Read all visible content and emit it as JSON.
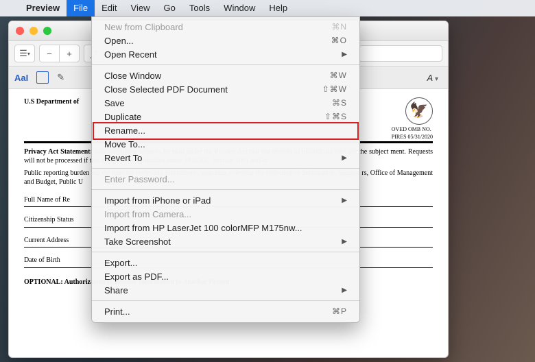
{
  "menubar": {
    "app": "Preview",
    "items": [
      "File",
      "Edit",
      "View",
      "Go",
      "Tools",
      "Window",
      "Help"
    ],
    "active": "File"
  },
  "file_menu": [
    {
      "label": "New from Clipboard",
      "shortcut": "⌘N",
      "disabled": true
    },
    {
      "label": "Open...",
      "shortcut": "⌘O"
    },
    {
      "label": "Open Recent",
      "submenu": true
    },
    {
      "sep": true
    },
    {
      "label": "Close Window",
      "shortcut": "⌘W"
    },
    {
      "label": "Close Selected PDF Document",
      "shortcut": "⇧⌘W"
    },
    {
      "label": "Save",
      "shortcut": "⌘S"
    },
    {
      "label": "Duplicate",
      "shortcut": "⇧⌘S"
    },
    {
      "label": "Rename..."
    },
    {
      "label": "Move To..."
    },
    {
      "label": "Revert To",
      "submenu": true
    },
    {
      "sep": true
    },
    {
      "label": "Enter Password...",
      "disabled": true
    },
    {
      "sep": true
    },
    {
      "label": "Import from iPhone or iPad",
      "submenu": true
    },
    {
      "label": "Import from Camera...",
      "disabled": true
    },
    {
      "label": "Import from HP LaserJet 100 colorMFP M175nw..."
    },
    {
      "label": "Take Screenshot",
      "submenu": true
    },
    {
      "sep": true
    },
    {
      "label": "Export..."
    },
    {
      "label": "Export as PDF..."
    },
    {
      "label": "Share",
      "submenu": true
    },
    {
      "sep": true
    },
    {
      "label": "Print...",
      "shortcut": "⌘P"
    }
  ],
  "highlight_label": "Rename...",
  "markup": {
    "text_tool": "AaI",
    "font_label": "A"
  },
  "doc": {
    "dept": "U.S Department of",
    "omb1": "OVED OMB NO.",
    "omb2": "PIRES 05/31/2020",
    "p1_lead": "Privacy Act Statement:",
    "p1": " uals submitting requests by mail under the Privacy Act that the records of individuals who are the subject ment. Requests will not be processed if this information d penalties under 18 U.S.C. Section 1001 and/or",
    "p2": "Public reporting burden ing the time for reviewing instructions, searching eviewing the collection of information. Suggest rs, Office of Management and Budget, Public U",
    "f1": "Full Name of Re",
    "f2": "Citizenship Status",
    "f3": "Current Address",
    "f4": "Date of Birth",
    "opt": "OPTIONAL:  Authorization to Release Information to Another Person"
  }
}
